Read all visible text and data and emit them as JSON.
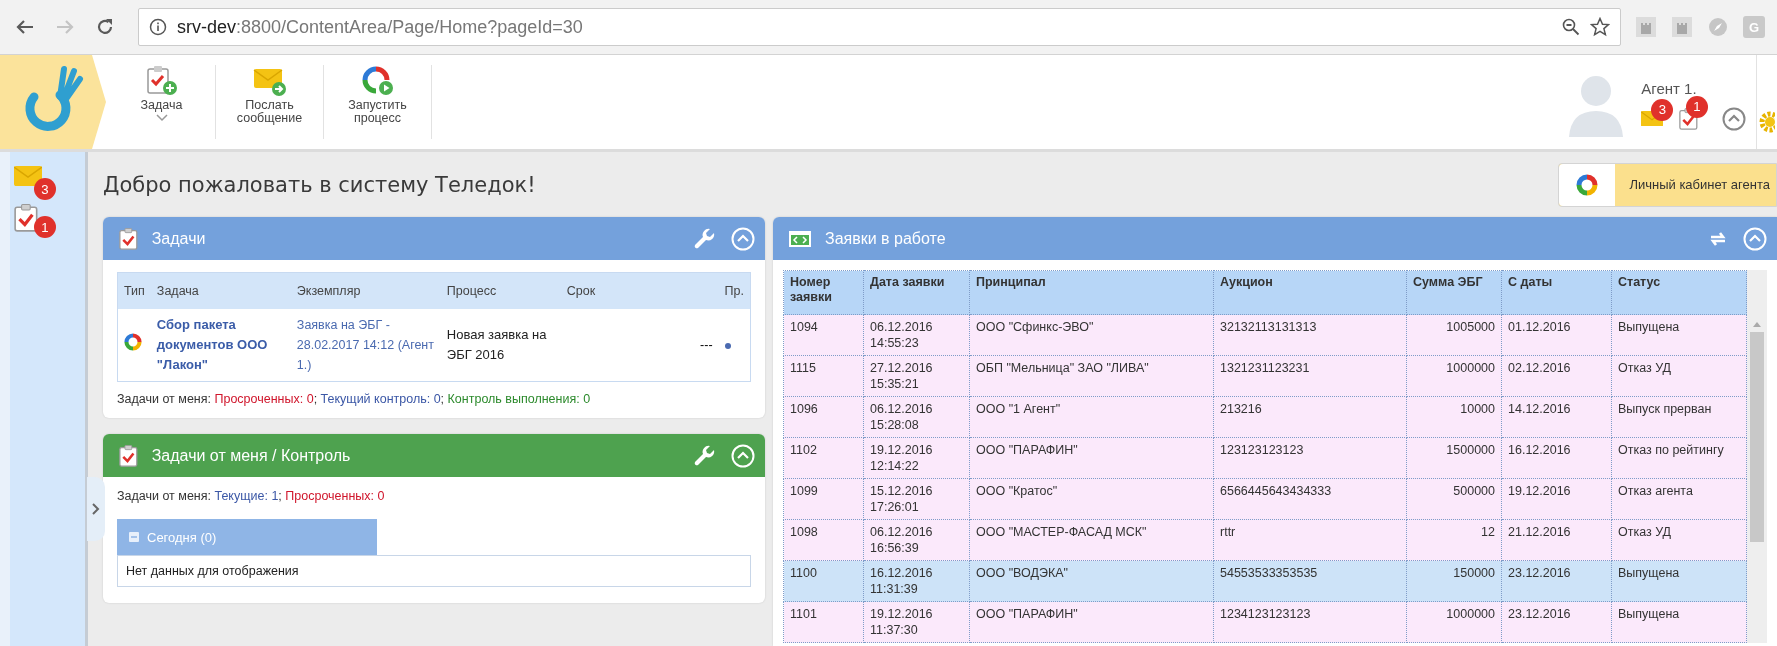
{
  "browser": {
    "nav": [
      {
        "kind": "back",
        "disabled": false
      },
      {
        "kind": "forward",
        "disabled": true
      },
      {
        "kind": "reload",
        "disabled": false
      }
    ],
    "url": {
      "host": "srv-dev",
      "path": ":8800/ContentArea/Page/Home?pageId=30"
    },
    "extensions": [
      {
        "kind": "castle"
      },
      {
        "kind": "castle"
      },
      {
        "kind": "compass"
      },
      {
        "kind": "letter",
        "label": "G"
      }
    ]
  },
  "toolbar": {
    "actions": [
      {
        "kind": "task",
        "label": "Задача",
        "dropdown": true
      },
      {
        "kind": "message",
        "label": "Послать сообщение",
        "dropdown": false
      },
      {
        "kind": "process",
        "label": "Запустить процесс",
        "dropdown": false
      }
    ]
  },
  "user": {
    "name": "Агент 1.",
    "notifications": [
      {
        "kind": "mail",
        "count": "3"
      },
      {
        "kind": "task",
        "count": "1"
      }
    ]
  },
  "sidebar": {
    "items": [
      {
        "kind": "mail",
        "count": "3"
      },
      {
        "kind": "task",
        "count": "1"
      }
    ]
  },
  "welcome": "Добро пожаловать в систему Теледок!",
  "cabinet_button": "Личный кабинет агента",
  "tasks_panel": {
    "title": "Задачи",
    "columns": [
      "Тип",
      "Задача",
      "Экземпляр",
      "Процесс",
      "Срок",
      "Пр."
    ],
    "rows": [
      {
        "task": "Сбор пакета документов ООО \"Лакон\"",
        "instance": "Заявка на ЭБГ - 28.02.2017 14:12 (Агент 1.)",
        "process": "Новая заявка на ЭБГ 2016",
        "deadline": "---"
      }
    ],
    "summary": [
      {
        "text": "Задачи от меня: ",
        "kind": "plain"
      },
      {
        "text": "Просроченных: 0",
        "kind": "overdue"
      },
      {
        "text": "; ",
        "kind": "plain"
      },
      {
        "text": "Текущий контроль: 0",
        "kind": "current"
      },
      {
        "text": "; ",
        "kind": "plain"
      },
      {
        "text": "Контроль выполнения: 0",
        "kind": "done"
      }
    ]
  },
  "control_panel": {
    "title": "Задачи от меня / Контроль",
    "summary": [
      {
        "text": "Задачи от меня: ",
        "kind": "plain"
      },
      {
        "text": "Текущие: 1",
        "kind": "current"
      },
      {
        "text": "; ",
        "kind": "plain"
      },
      {
        "text": "Просроченных: 0",
        "kind": "overdue"
      }
    ],
    "group": {
      "label": "Сегодня (0)",
      "expanded": true
    },
    "empty": "Нет данных для отображения"
  },
  "requests": {
    "title": "Заявки в работе",
    "columns": [
      "Номер заявки",
      "Дата заявки",
      "Принципал",
      "Аукцион",
      "Сумма ЭБГ",
      "С даты",
      "Статус"
    ],
    "rows": [
      {
        "cells": [
          "1094",
          "06.12.2016 14:55:23",
          "ООО \"Сфинкс-ЭВО\"",
          "32132113131313",
          "1005000",
          "01.12.2016",
          "Выпущена"
        ],
        "selected": false
      },
      {
        "cells": [
          "1115",
          "27.12.2016 15:35:21",
          "ОБП \"Мельница\" ЗАО \"ЛИВА\"",
          "1321231123231",
          "1000000",
          "02.12.2016",
          "Отказ УД"
        ],
        "selected": false
      },
      {
        "cells": [
          "1096",
          "06.12.2016 15:28:08",
          "ООО \"1 Агент\"",
          "213216",
          "10000",
          "14.12.2016",
          "Выпуск прерван"
        ],
        "selected": false
      },
      {
        "cells": [
          "1102",
          "19.12.2016 12:14:22",
          "ООО \"ПАРАФИН\"",
          "123123123123",
          "1500000",
          "16.12.2016",
          "Отказ по рейтингу"
        ],
        "selected": false
      },
      {
        "cells": [
          "1099",
          "15.12.2016 17:26:01",
          "ООО \"Кратос\"",
          "6566445643434333",
          "500000",
          "19.12.2016",
          "Отказ агента"
        ],
        "selected": false
      },
      {
        "cells": [
          "1098",
          "06.12.2016 16:56:39",
          "ООО \"МАСТЕР-ФАСАД МСК\"",
          "rttr",
          "12",
          "21.12.2016",
          "Отказ УД"
        ],
        "selected": false
      },
      {
        "cells": [
          "1100",
          "16.12.2016 11:31:39",
          "ООО \"ВОДЭКА\"",
          "54553533353535",
          "150000",
          "23.12.2016",
          "Выпущена"
        ],
        "selected": true
      },
      {
        "cells": [
          "1101",
          "19.12.2016 11:37:30",
          "ООО \"ПАРАФИН\"",
          "1234123123123",
          "1000000",
          "23.12.2016",
          "Выпущена"
        ],
        "selected": false
      }
    ]
  }
}
